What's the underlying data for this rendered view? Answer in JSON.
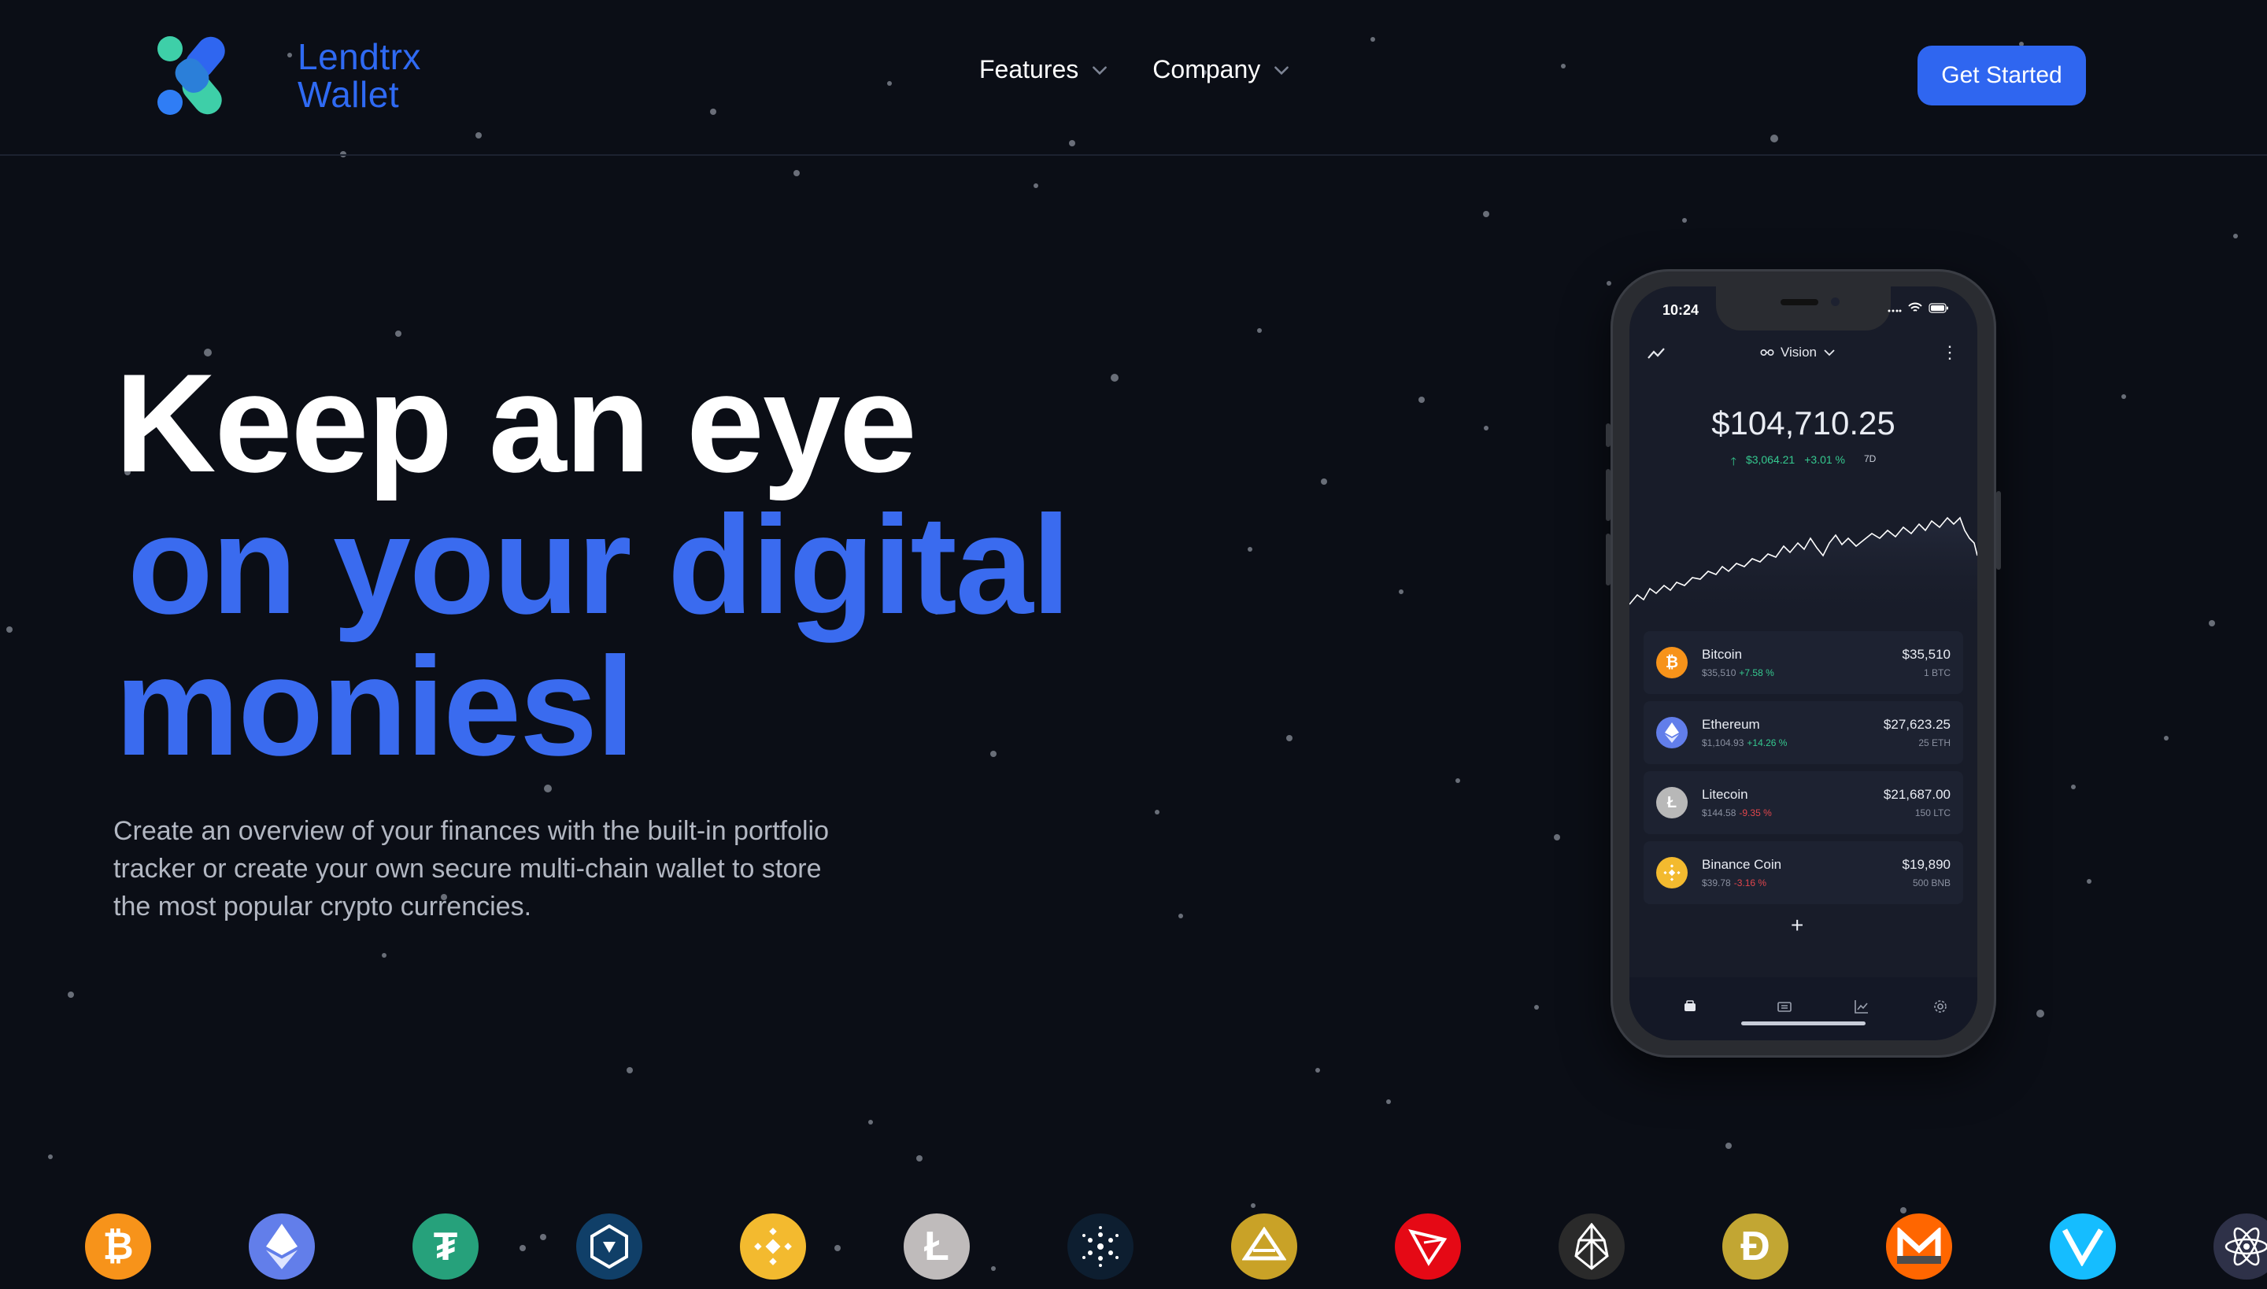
{
  "brand": {
    "line1": "Lendtrx",
    "line2": "Wallet"
  },
  "nav": [
    {
      "label": "Features"
    },
    {
      "label": "Company"
    }
  ],
  "cta": {
    "label": "Get Started"
  },
  "hero": {
    "line1": "Keep an eye",
    "line2": "on your digital",
    "line3": "moniesl",
    "subtitle": "Create an overview of your finances with the built-in portfolio tracker or create your own secure multi-chain wallet to store the most popular crypto currencies."
  },
  "phone": {
    "status_time": "10:24",
    "view_label": "Vision",
    "balance": "$104,710.25",
    "change_amount": "$3,064.21",
    "change_pct": "+3.01 %",
    "period": "7D",
    "coins": [
      {
        "name": "Bitcoin",
        "price": "$35,510",
        "pct": "+7.58 %",
        "value": "$35,510",
        "amount": "1 BTC",
        "color": "#f7931a",
        "icon": "bitcoin-icon"
      },
      {
        "name": "Ethereum",
        "price": "$1,104.93",
        "pct": "+14.26 %",
        "value": "$27,623.25",
        "amount": "25 ETH",
        "color": "#627eea",
        "icon": "ethereum-icon"
      },
      {
        "name": "Litecoin",
        "price": "$144.58",
        "pct": "-9.35 %",
        "value": "$21,687.00",
        "amount": "150 LTC",
        "color": "#b8b8b8",
        "icon": "litecoin-icon"
      },
      {
        "name": "Binance Coin",
        "price": "$39.78",
        "pct": "-3.16 %",
        "value": "$19,890",
        "amount": "500 BNB",
        "color": "#f3ba2f",
        "icon": "binance-icon"
      }
    ],
    "add_label": "+"
  },
  "colors": {
    "background": "#0b0e16",
    "accent": "#2f66f0",
    "positive": "#35c98f",
    "negative": "#e1464c"
  },
  "coin_strip": [
    {
      "icon": "bitcoin-icon",
      "color": "#f7931a"
    },
    {
      "icon": "ethereum-icon",
      "color": "#627eea"
    },
    {
      "icon": "tether-icon",
      "color": "#26a17b"
    },
    {
      "icon": "crypto-com-icon",
      "color": "#103f68"
    },
    {
      "icon": "binance-icon",
      "color": "#f3ba2f"
    },
    {
      "icon": "litecoin-icon",
      "color": "#bfbbbb"
    },
    {
      "icon": "cardano-icon",
      "color": "#0d1e30"
    },
    {
      "icon": "gold-coin-icon",
      "color": "#c9a227"
    },
    {
      "icon": "tron-icon",
      "color": "#e50915"
    },
    {
      "icon": "eos-icon",
      "color": "#2a2a2a"
    },
    {
      "icon": "dogecoin-icon",
      "color": "#c2a633"
    },
    {
      "icon": "monero-icon",
      "color": "#ff6600"
    },
    {
      "icon": "vechain-icon",
      "color": "#15bdff"
    },
    {
      "icon": "cosmos-icon",
      "color": "#2e3148"
    }
  ]
}
